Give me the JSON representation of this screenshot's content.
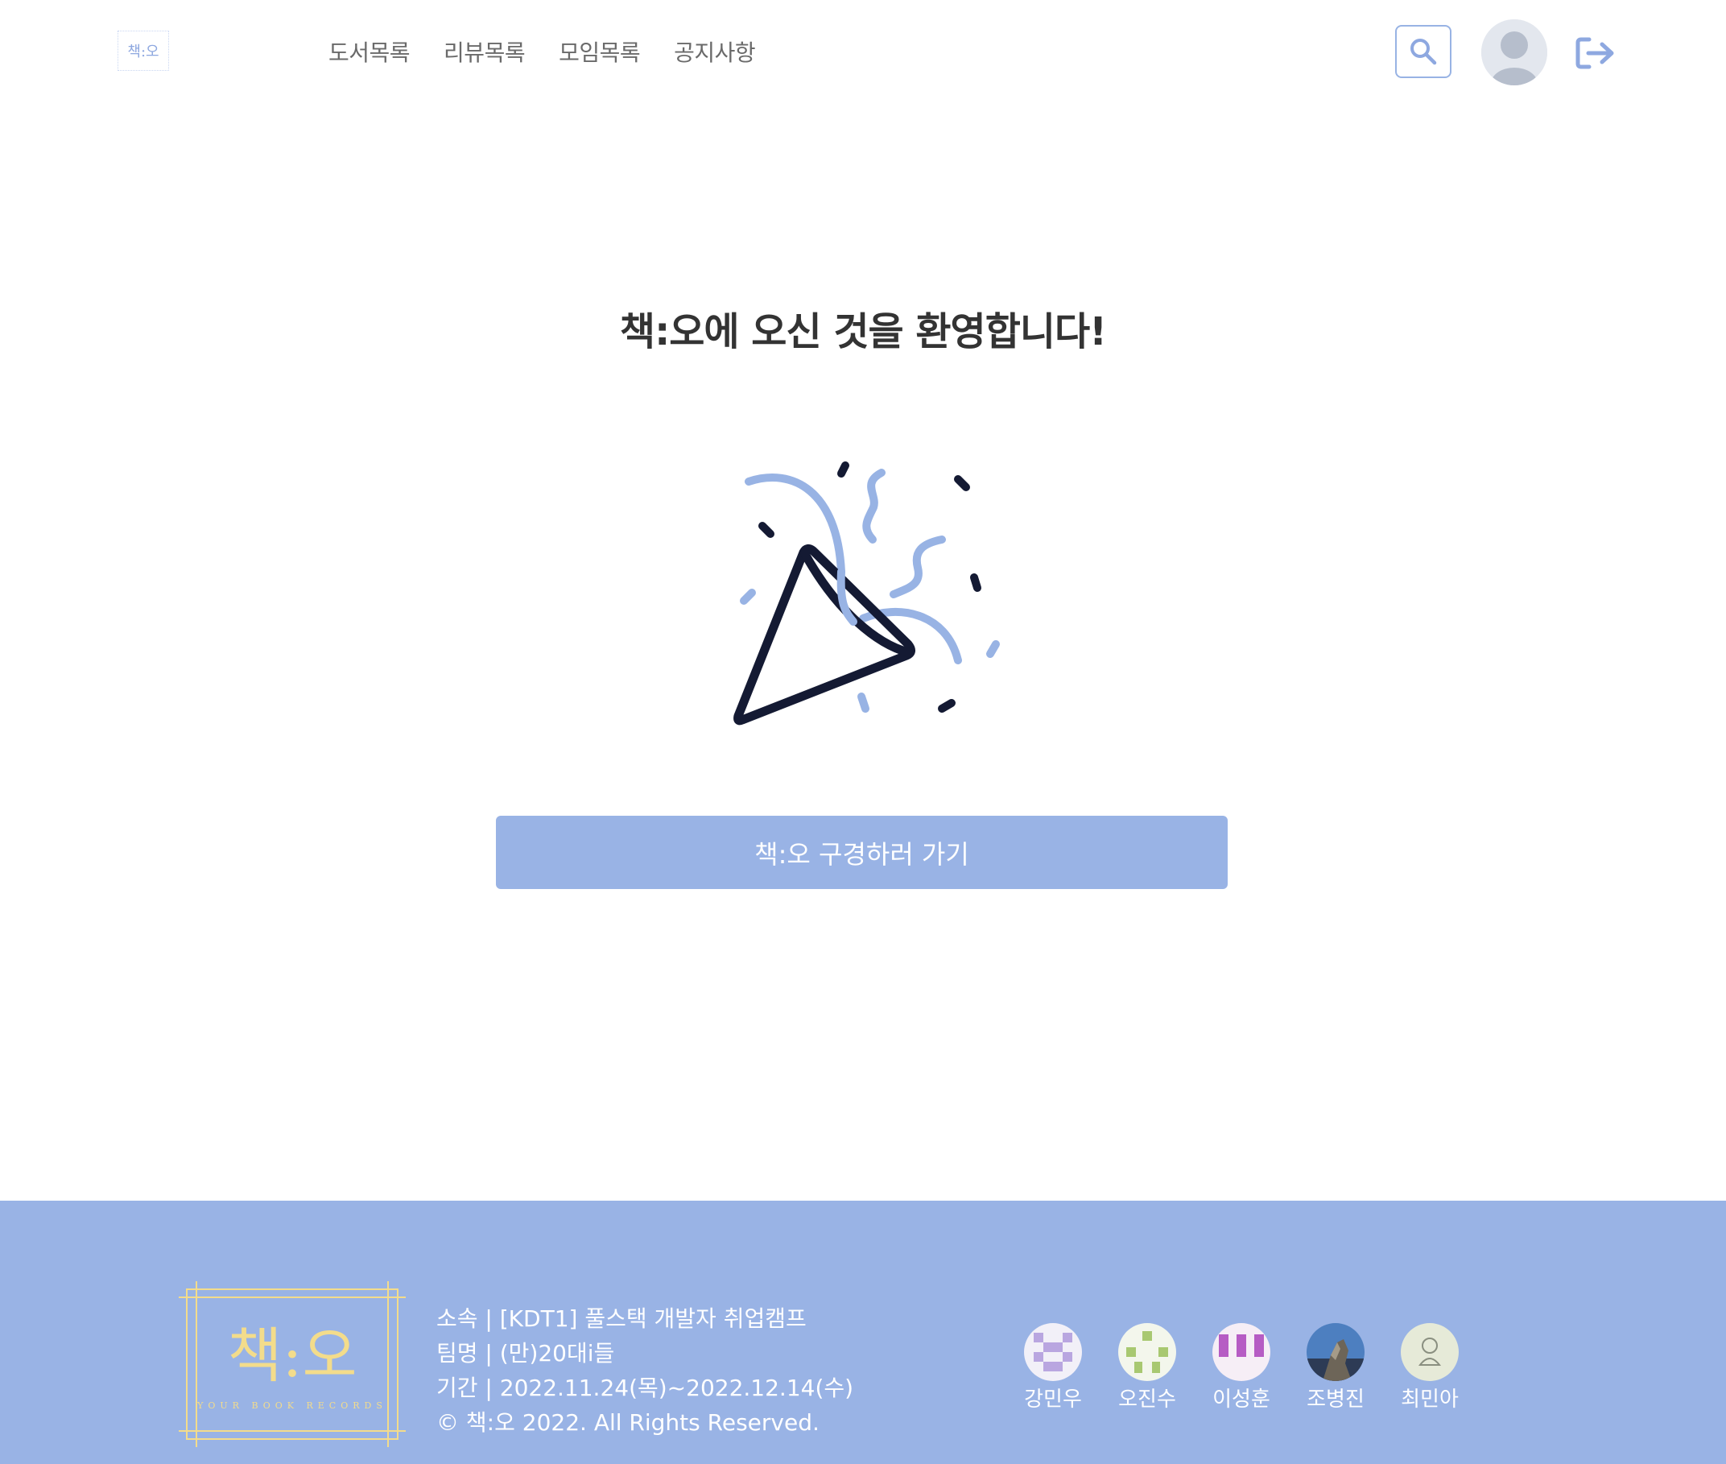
{
  "brand": {
    "logo_text": "책:오",
    "tagline": "YOUR BOOK RECORDS"
  },
  "nav": {
    "items": [
      {
        "label": "도서목록"
      },
      {
        "label": "리뷰목록"
      },
      {
        "label": "모임목록"
      },
      {
        "label": "공지사항"
      }
    ]
  },
  "header": {
    "search_icon": "search-icon",
    "avatar_icon": "user-avatar",
    "logout_icon": "logout-icon"
  },
  "main": {
    "title": "책:오에 오신 것을 환영합니다!",
    "illustration": "party-popper-icon",
    "cta_label": "책:오 구경하러 가기"
  },
  "footer": {
    "info": [
      "소속 | [KDT1] 풀스택 개발자 취업캠프",
      "팀명 | (만)20대i들",
      "기간 | 2022.11.24(목)~2022.12.14(수)",
      "© 책:오 2022. All Rights Reserved."
    ],
    "members": [
      {
        "name": "강민우"
      },
      {
        "name": "오진수"
      },
      {
        "name": "이성훈"
      },
      {
        "name": "조병진"
      },
      {
        "name": "최민아"
      }
    ]
  },
  "colors": {
    "accent": "#99b3e5",
    "text": "#333333",
    "nav_text": "#6a6a6a",
    "logo_gold": "#f3dc8b",
    "dark": "#141a33"
  }
}
